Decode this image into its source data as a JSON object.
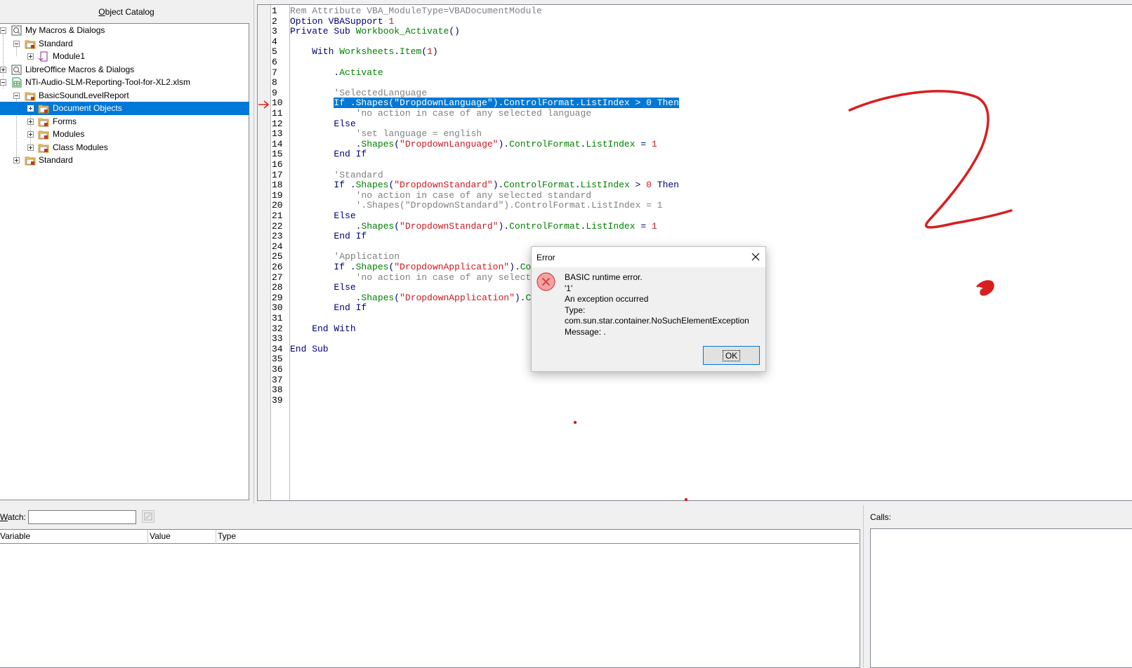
{
  "catalog": {
    "title_underlined": "O",
    "title_rest": "bject Catalog",
    "tree": [
      {
        "label": "My Macros & Dialogs"
      },
      {
        "label": "Standard"
      },
      {
        "label": "Module1"
      },
      {
        "label": "LibreOffice Macros & Dialogs"
      },
      {
        "label": "NTi-Audio-SLM-Reporting-Tool-for-XL2.xlsm"
      },
      {
        "label": "BasicSoundLevelReport"
      },
      {
        "label": "Document Objects"
      },
      {
        "label": "Forms"
      },
      {
        "label": "Modules"
      },
      {
        "label": "Class Modules"
      },
      {
        "label": "Standard"
      }
    ]
  },
  "editor": {
    "line_numbers": [
      "1",
      "2",
      "3",
      "4",
      "5",
      "6",
      "7",
      "8",
      "9",
      "10",
      "11",
      "12",
      "13",
      "14",
      "15",
      "16",
      "17",
      "18",
      "19",
      "20",
      "21",
      "22",
      "23",
      "24",
      "25",
      "26",
      "27",
      "28",
      "29",
      "30",
      "31",
      "32",
      "33",
      "34",
      "35",
      "36",
      "37",
      "38",
      "39"
    ],
    "lines": [
      [
        {
          "t": "Rem Attribute VBA_ModuleType=VBADocumentModule",
          "c": "cm"
        }
      ],
      [
        {
          "t": "Option VBASupport ",
          "c": "kw"
        },
        {
          "t": "1",
          "c": "nm"
        }
      ],
      [
        {
          "t": "Private Sub ",
          "c": "kw"
        },
        {
          "t": "Workbook_Activate",
          "c": "id"
        },
        {
          "t": "()",
          "c": "kw"
        }
      ],
      [],
      [
        {
          "t": "    With ",
          "c": "kw"
        },
        {
          "t": "Worksheets",
          "c": "id"
        },
        {
          "t": ".",
          "c": "kw"
        },
        {
          "t": "Item",
          "c": "id"
        },
        {
          "t": "(",
          "c": "kw"
        },
        {
          "t": "1",
          "c": "nm"
        },
        {
          "t": ")",
          "c": "kw"
        }
      ],
      [],
      [
        {
          "t": "        .",
          "c": "kw"
        },
        {
          "t": "Activate",
          "c": "id"
        }
      ],
      [],
      [
        {
          "t": "        'SelectedLanguage",
          "c": "cm"
        }
      ],
      [
        {
          "t": "        ",
          "c": ""
        },
        {
          "t": "If .Shapes(\"DropdownLanguage\").ControlFormat.ListIndex > 0 Then",
          "c": "hl"
        }
      ],
      [
        {
          "t": "            'no action in case of any selected language",
          "c": "cm"
        }
      ],
      [
        {
          "t": "        Else",
          "c": "kw"
        }
      ],
      [
        {
          "t": "            'set language = english",
          "c": "cm"
        }
      ],
      [
        {
          "t": "            .",
          "c": "kw"
        },
        {
          "t": "Shapes",
          "c": "id"
        },
        {
          "t": "(",
          "c": "kw"
        },
        {
          "t": "\"DropdownLanguage\"",
          "c": "st"
        },
        {
          "t": ").",
          "c": "kw"
        },
        {
          "t": "ControlFormat",
          "c": "id"
        },
        {
          "t": ".",
          "c": "kw"
        },
        {
          "t": "ListIndex",
          "c": "id"
        },
        {
          "t": " = ",
          "c": "kw"
        },
        {
          "t": "1",
          "c": "nm"
        }
      ],
      [
        {
          "t": "        End If",
          "c": "kw"
        }
      ],
      [],
      [
        {
          "t": "        'Standard",
          "c": "cm"
        }
      ],
      [
        {
          "t": "        If .",
          "c": "kw"
        },
        {
          "t": "Shapes",
          "c": "id"
        },
        {
          "t": "(",
          "c": "kw"
        },
        {
          "t": "\"DropdownStandard\"",
          "c": "st"
        },
        {
          "t": ").",
          "c": "kw"
        },
        {
          "t": "ControlFormat",
          "c": "id"
        },
        {
          "t": ".",
          "c": "kw"
        },
        {
          "t": "ListIndex",
          "c": "id"
        },
        {
          "t": " > ",
          "c": "kw"
        },
        {
          "t": "0",
          "c": "nm"
        },
        {
          "t": " Then",
          "c": "kw"
        }
      ],
      [
        {
          "t": "            'no action in case of any selected standard",
          "c": "cm"
        }
      ],
      [
        {
          "t": "            '.Shapes(\"DropdownStandard\").ControlFormat.ListIndex = 1",
          "c": "cm"
        }
      ],
      [
        {
          "t": "        Else",
          "c": "kw"
        }
      ],
      [
        {
          "t": "            .",
          "c": "kw"
        },
        {
          "t": "Shapes",
          "c": "id"
        },
        {
          "t": "(",
          "c": "kw"
        },
        {
          "t": "\"DropdownStandard\"",
          "c": "st"
        },
        {
          "t": ").",
          "c": "kw"
        },
        {
          "t": "ControlFormat",
          "c": "id"
        },
        {
          "t": ".",
          "c": "kw"
        },
        {
          "t": "ListIndex",
          "c": "id"
        },
        {
          "t": " = ",
          "c": "kw"
        },
        {
          "t": "1",
          "c": "nm"
        }
      ],
      [
        {
          "t": "        End If",
          "c": "kw"
        }
      ],
      [],
      [
        {
          "t": "        'Application",
          "c": "cm"
        }
      ],
      [
        {
          "t": "        If .",
          "c": "kw"
        },
        {
          "t": "Shapes",
          "c": "id"
        },
        {
          "t": "(",
          "c": "kw"
        },
        {
          "t": "\"DropdownApplication\"",
          "c": "st"
        },
        {
          "t": ").",
          "c": "kw"
        },
        {
          "t": "Co",
          "c": "id"
        }
      ],
      [
        {
          "t": "            'no action in case of any select",
          "c": "cm"
        }
      ],
      [
        {
          "t": "        Else",
          "c": "kw"
        }
      ],
      [
        {
          "t": "            .",
          "c": "kw"
        },
        {
          "t": "Shapes",
          "c": "id"
        },
        {
          "t": "(",
          "c": "kw"
        },
        {
          "t": "\"DropdownApplication\"",
          "c": "st"
        },
        {
          "t": ").",
          "c": "kw"
        },
        {
          "t": "C",
          "c": "id"
        }
      ],
      [
        {
          "t": "        End If",
          "c": "kw"
        }
      ],
      [],
      [
        {
          "t": "    End With",
          "c": "kw"
        }
      ],
      [],
      [
        {
          "t": "End Sub",
          "c": "kw"
        }
      ],
      [],
      [],
      [],
      [],
      []
    ]
  },
  "watch": {
    "label_underlined": "W",
    "label_rest": "atch:",
    "input_value": "",
    "columns": [
      "Variable",
      "Value",
      "Type"
    ]
  },
  "calls": {
    "label": "Calls:"
  },
  "dialog": {
    "title": "Error",
    "message_lines": [
      "BASIC runtime error.",
      "'1'",
      "An exception occurred",
      "Type: com.sun.star.container.NoSuchElementException",
      "Message: ."
    ],
    "ok_label": "OK"
  },
  "colors": {
    "selection": "#0078d7",
    "keyword": "#000080",
    "comment": "#808080",
    "string": "#ce181e",
    "identifier": "#008000",
    "annotation": "#d91e1e"
  }
}
